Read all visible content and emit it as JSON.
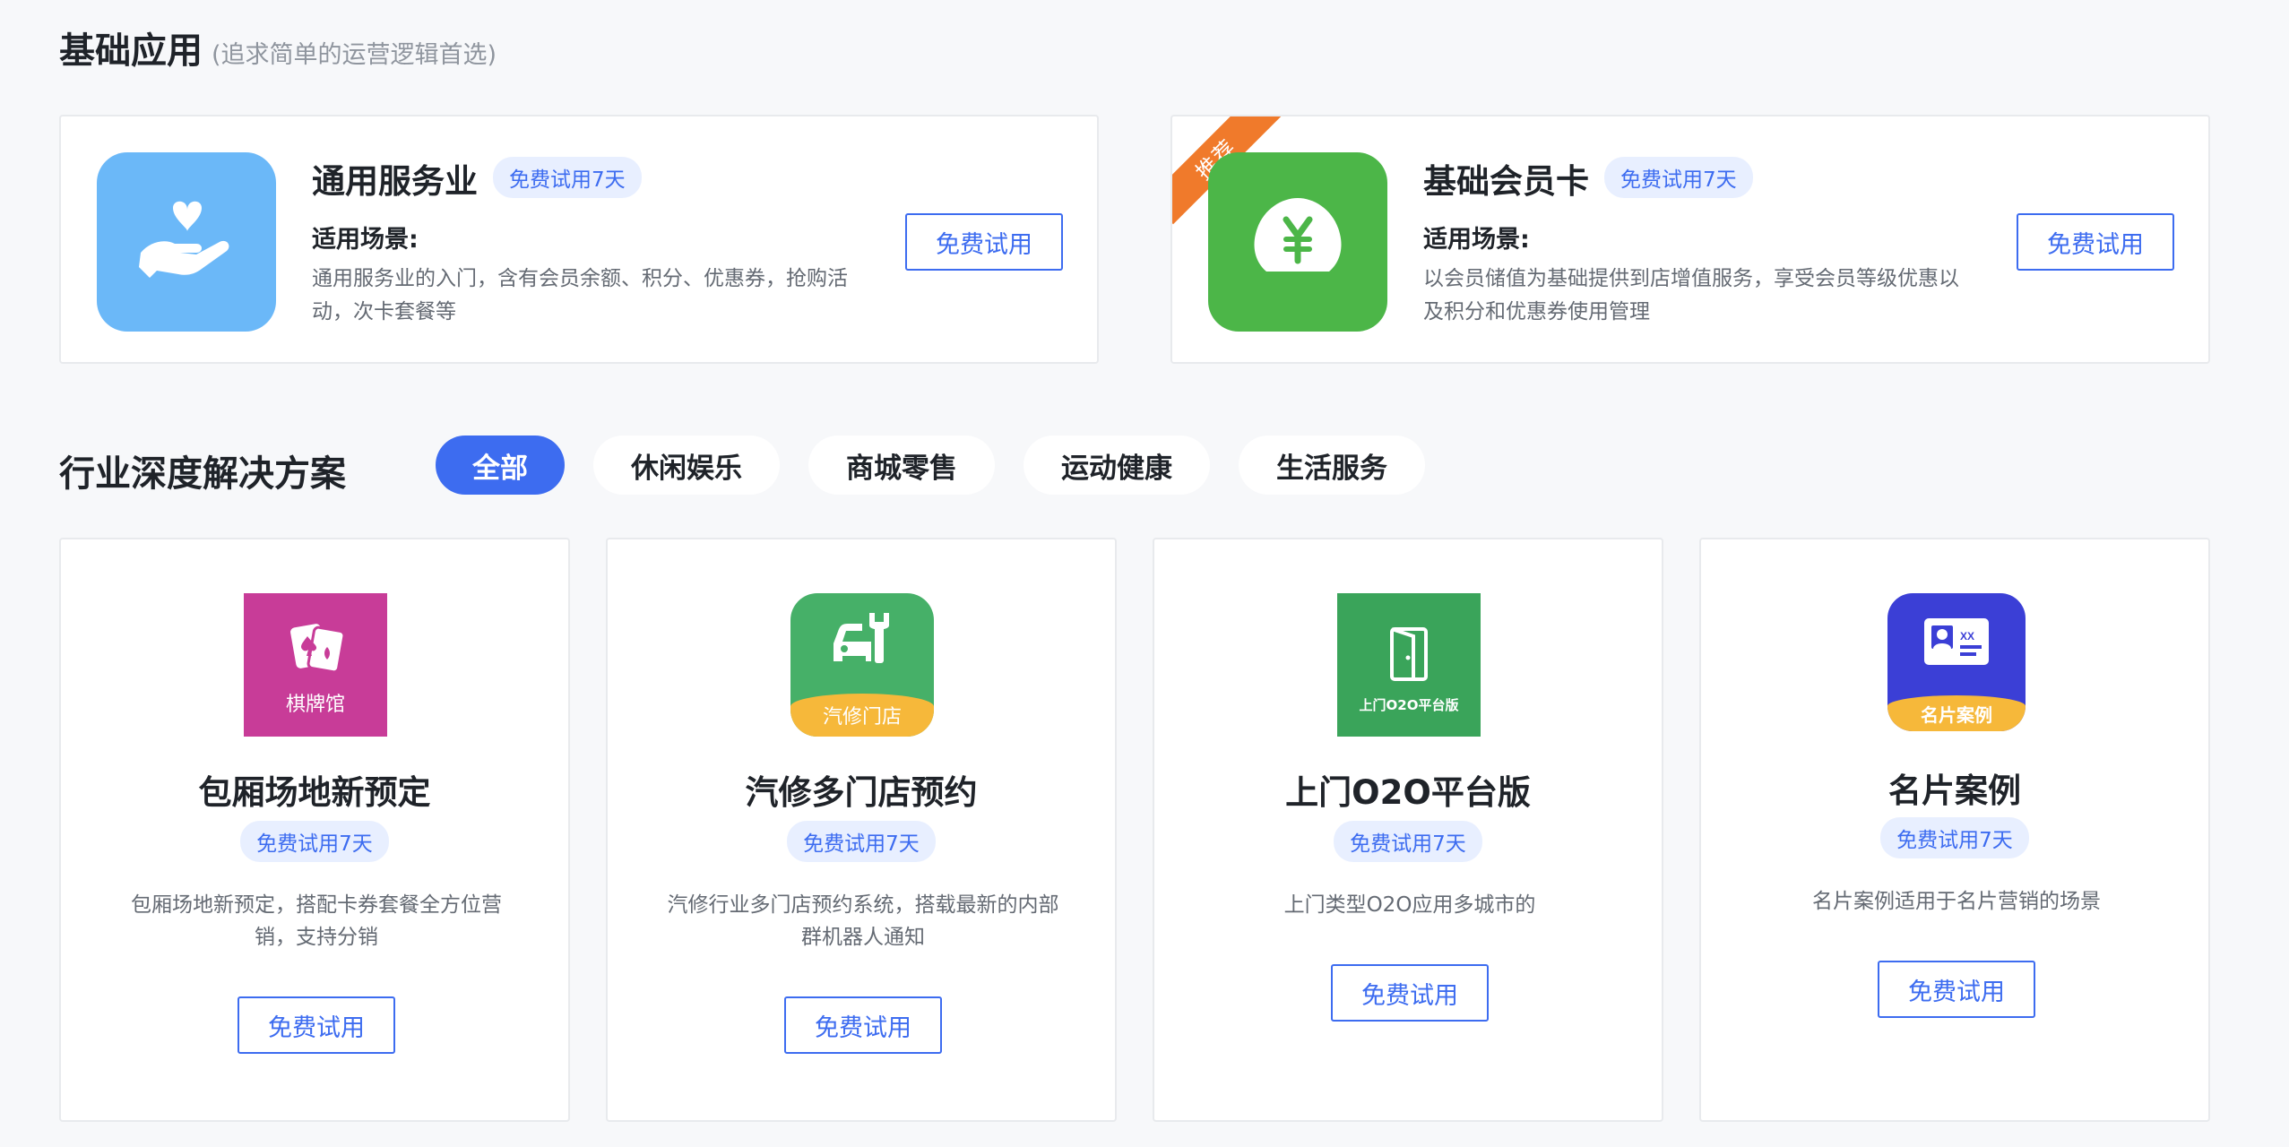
{
  "basic": {
    "title": "基础应用",
    "subtitle": "(追求简单的运营逻辑首选)",
    "cards": [
      {
        "name": "通用服务业",
        "badge": "免费试用7天",
        "scene_label": "适用场景:",
        "desc": "通用服务业的入门，含有会员余额、积分、优惠券，抢购活动，次卡套餐等",
        "button": "免费试用",
        "icon": "heart-hand-icon",
        "icon_color": "#6bb8f8"
      },
      {
        "name": "基础会员卡",
        "badge": "免费试用7天",
        "scene_label": "适用场景:",
        "desc": "以会员储值为基础提供到店增值服务，享受会员等级优惠以及积分和优惠券使用管理",
        "button": "免费试用",
        "ribbon": "推荐",
        "icon": "yen-coin-icon",
        "icon_color": "#4cb648"
      }
    ]
  },
  "solutions": {
    "title": "行业深度解决方案",
    "tabs": [
      "全部",
      "休闲娱乐",
      "商城零售",
      "运动健康",
      "生活服务"
    ],
    "active_tab": "全部",
    "cards": [
      {
        "name": "包厢场地新预定",
        "badge": "免费试用7天",
        "desc": "包厢场地新预定，搭配卡券套餐全方位营销，支持分销",
        "button": "免费试用",
        "icon": "playing-cards-icon",
        "icon_label": "棋牌馆",
        "icon_color": "#c83c98"
      },
      {
        "name": "汽修多门店预约",
        "badge": "免费试用7天",
        "desc": "汽修行业多门店预约系统，搭载最新的内部群机器人通知",
        "button": "免费试用",
        "icon": "car-wrench-icon",
        "icon_label": "汽修门店",
        "icon_color": "#46b068"
      },
      {
        "name": "上门O2O平台版",
        "badge": "免费试用7天",
        "desc": "上门类型O2O应用多城市的",
        "button": "免费试用",
        "icon": "door-icon",
        "icon_label": "上门O2O平台版",
        "icon_color": "#3aa45a"
      },
      {
        "name": "名片案例",
        "badge": "免费试用7天",
        "desc": "名片案例适用于名片营销的场景",
        "button": "免费试用",
        "icon": "business-card-icon",
        "icon_label": "名片案例",
        "icon_color": "#3b3fd6"
      }
    ]
  }
}
